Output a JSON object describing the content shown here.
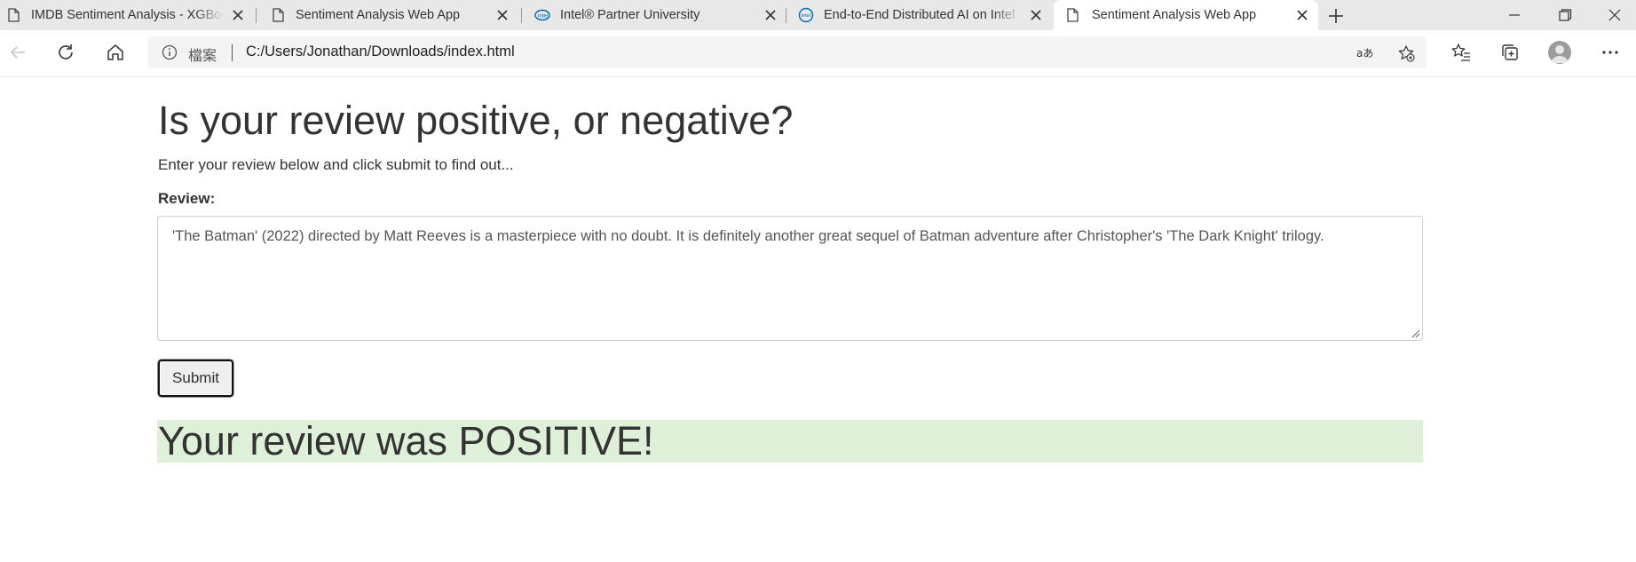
{
  "browser": {
    "tabs": [
      {
        "title": "IMDB Sentiment Analysis - XGBoost",
        "icon": "page-icon",
        "active": false
      },
      {
        "title": "Sentiment Analysis Web App",
        "icon": "page-icon",
        "active": false
      },
      {
        "title": "Intel® Partner University",
        "icon": "intel-logo-icon",
        "active": false
      },
      {
        "title": "End-to-End Distributed AI on Intel",
        "icon": "intel-logo-icon",
        "active": false
      },
      {
        "title": "Sentiment Analysis Web App",
        "icon": "page-icon",
        "active": true
      }
    ],
    "address_bar": {
      "chip": "檔案",
      "url": "C:/Users/Jonathan/Downloads/index.html"
    }
  },
  "page": {
    "title": "Is your review positive, or negative?",
    "subtitle": "Enter your review below and click submit to find out...",
    "review_label": "Review:",
    "review_text": "'The Batman' (2022) directed by Matt Reeves is a masterpiece with no doubt. It is definitely another great sequel of Batman adventure after Christopher's 'The Dark Knight' trilogy.",
    "submit_label": "Submit",
    "result": "Your review was POSITIVE!"
  },
  "colors": {
    "result_background": "#dff0d8",
    "text": "#333333"
  }
}
